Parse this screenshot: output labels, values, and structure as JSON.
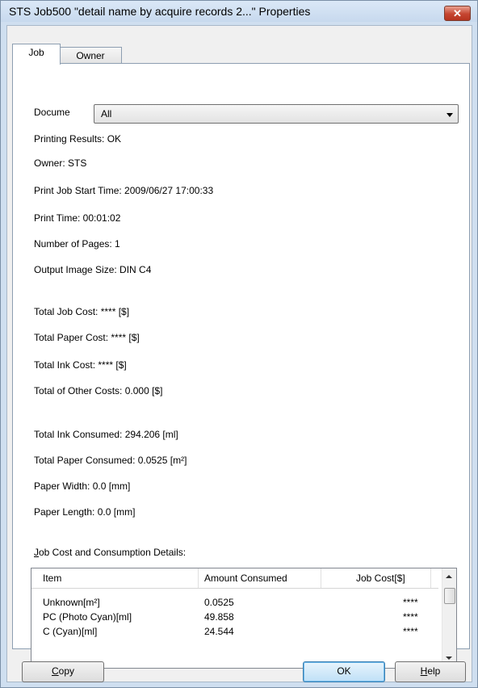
{
  "window": {
    "title": "STS Job500 \"detail name by acquire records 2...\" Properties",
    "close_label": "✕"
  },
  "tabs": [
    {
      "label": "Job",
      "active": true
    },
    {
      "label": "Owner",
      "active": false
    }
  ],
  "document_select": {
    "label": "Docume",
    "value": "All"
  },
  "info": {
    "printing_results": "Printing Results: OK",
    "owner": "Owner: STS",
    "start_time": "Print Job Start Time: 2009/06/27 17:00:33",
    "print_time": "Print Time: 00:01:02",
    "pages": "Number of Pages: 1",
    "image_size": "Output Image Size: DIN C4"
  },
  "costs": {
    "total_job": "Total Job Cost: **** [$]",
    "total_paper": "Total Paper Cost: **** [$]",
    "total_ink": "Total Ink Cost: **** [$]",
    "total_other": "Total of Other Costs: 0.000 [$]"
  },
  "consumption": {
    "ink": "Total Ink Consumed: 294.206 [ml]",
    "paper": "Total Paper Consumed: 0.0525 [m²]",
    "width": "Paper Width: 0.0 [mm]",
    "length": "Paper Length: 0.0 [mm]"
  },
  "details": {
    "heading_first": "J",
    "heading_rest": "ob Cost and Consumption Details:",
    "columns": [
      "Item",
      "Amount Consumed",
      "Job Cost[$]"
    ],
    "rows": [
      {
        "item": "Unknown[m²]",
        "amount": "0.0525",
        "cost": "****"
      },
      {
        "item": "PC (Photo Cyan)[ml]",
        "amount": "49.858",
        "cost": "****"
      },
      {
        "item": "C (Cyan)[ml]",
        "amount": "24.544",
        "cost": "****"
      }
    ]
  },
  "buttons": {
    "copy_first": "C",
    "copy_rest": "opy",
    "ok": "OK",
    "help_first": "H",
    "help_rest": "elp"
  }
}
